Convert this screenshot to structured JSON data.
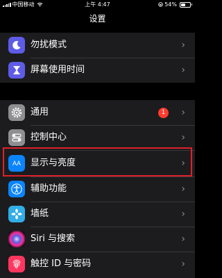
{
  "status_bar": {
    "carrier": "中国移动",
    "time": "上午 4:47",
    "battery_text": "54%",
    "battery_level": 0.54
  },
  "nav": {
    "title": "设置"
  },
  "group1": [
    {
      "label": "勿扰模式",
      "icon": "moon-icon",
      "color": "#5e5ce6"
    },
    {
      "label": "屏幕使用时间",
      "icon": "hourglass-icon",
      "color": "#5e5ce6"
    }
  ],
  "group2": [
    {
      "label": "通用",
      "icon": "gear-icon",
      "color": "#8e8e93",
      "badge": "1"
    },
    {
      "label": "控制中心",
      "icon": "toggles-icon",
      "color": "#8e8e93"
    },
    {
      "label": "显示与亮度",
      "icon": "display-aa-icon",
      "color": "#0a84ff",
      "icon_text": "AA"
    },
    {
      "label": "辅助功能",
      "icon": "accessibility-icon",
      "color": "#0a84ff"
    },
    {
      "label": "墙纸",
      "icon": "wallpaper-icon",
      "color": "#32ade6"
    },
    {
      "label": "Siri 与搜索",
      "icon": "siri-icon",
      "color": "#1c1c1e"
    },
    {
      "label": "触控 ID 与密码",
      "icon": "fingerprint-icon",
      "color": "#ff375f"
    }
  ],
  "chevron": "›"
}
